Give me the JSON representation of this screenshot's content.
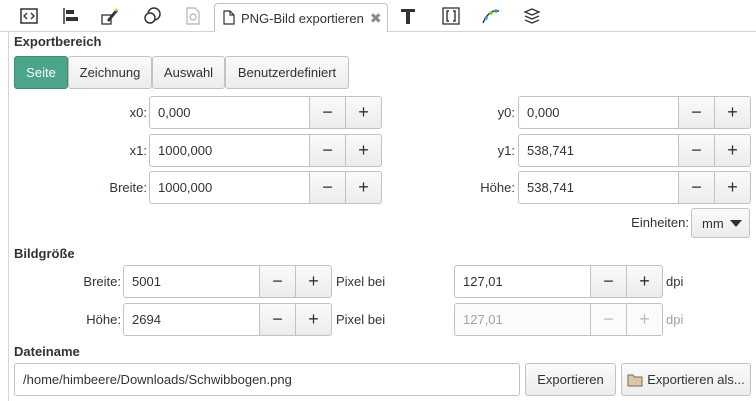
{
  "tab": {
    "title": "PNG-Bild exportieren",
    "close": "✖"
  },
  "export_area": {
    "title": "Exportbereich",
    "buttons": [
      "Seite",
      "Zeichnung",
      "Auswahl",
      "Benutzerdefiniert"
    ],
    "x0": {
      "label": "x0:",
      "value": "0,000"
    },
    "y0": {
      "label": "y0:",
      "value": "0,000"
    },
    "x1": {
      "label": "x1:",
      "value": "1000,000"
    },
    "y1": {
      "label": "y1:",
      "value": "538,741"
    },
    "width": {
      "label": "Breite:",
      "value": "1000,000"
    },
    "height": {
      "label": "Höhe:",
      "value": "538,741"
    },
    "units_label": "Einheiten:",
    "units_value": "mm"
  },
  "image_size": {
    "title": "Bildgröße",
    "width": {
      "label": "Breite:",
      "value": "5001"
    },
    "height": {
      "label": "Höhe:",
      "value": "2694"
    },
    "pixel_at": "Pixel bei",
    "dpi_x": "127,01",
    "dpi_y": "127,01",
    "dpi_unit": "dpi"
  },
  "filename": {
    "title": "Dateiname",
    "path": "/home/himbeere/Downloads/Schwibbogen.png",
    "export_button": "Exportieren",
    "export_as_button": "Exportieren als..."
  },
  "stepper": {
    "minus": "−",
    "plus": "+"
  }
}
